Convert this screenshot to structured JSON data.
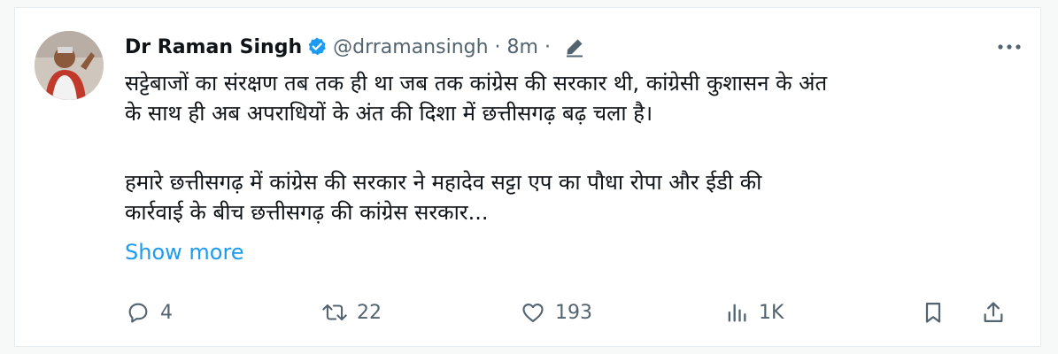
{
  "tweet": {
    "author": {
      "name": "Dr Raman Singh",
      "handle": "@drramansingh",
      "separator": "·",
      "time": "8m",
      "verified_color": "#1d9bf0"
    },
    "lines": [
      "सट्टेबाजों का संरक्षण तब तक ही था जब तक कांग्रेस की सरकार थी, कांग्रेसी कुशासन के अंत",
      "के साथ ही अब अपराधियों के अंत की दिशा में छत्तीसगढ़ बढ़ चला है।",
      "हमारे छत्तीसगढ़ में कांग्रेस की सरकार ने महादेव सट्टा एप का पौधा रोपा और ईडी की",
      "कार्रवाई के बीच छत्तीसगढ़ की कांग्रेस सरकार..."
    ],
    "show_more": "Show more",
    "actions": {
      "reply": {
        "icon": "reply-icon",
        "count": "4"
      },
      "retweet": {
        "icon": "retweet-icon",
        "count": "22"
      },
      "like": {
        "icon": "heart-icon",
        "count": "193"
      },
      "views": {
        "icon": "views-icon",
        "count": "1K"
      },
      "bookmark": {
        "icon": "bookmark-icon"
      },
      "share": {
        "icon": "share-icon"
      }
    }
  },
  "colors": {
    "text": "#0f1419",
    "muted": "#536471",
    "link": "#1d9bf0"
  }
}
